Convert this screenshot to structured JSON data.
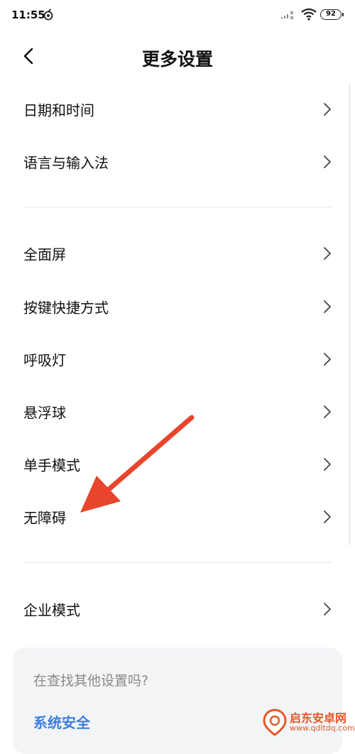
{
  "status_bar": {
    "time": "11:55",
    "battery": "92",
    "icons": [
      "app-notification-icon",
      "signal-off-icon",
      "wifi-icon",
      "battery-icon"
    ]
  },
  "header": {
    "title": "更多设置",
    "back_icon": "back-arrow-icon"
  },
  "settings": {
    "group1": [
      {
        "label": "日期和时间"
      },
      {
        "label": "语言与输入法"
      }
    ],
    "group2": [
      {
        "label": "全面屏"
      },
      {
        "label": "按键快捷方式"
      },
      {
        "label": "呼吸灯"
      },
      {
        "label": "悬浮球"
      },
      {
        "label": "单手模式"
      },
      {
        "label": "无障碍"
      }
    ],
    "group3": [
      {
        "label": "企业模式"
      }
    ]
  },
  "suggestion": {
    "title": "在查找其他设置吗?",
    "link": "系统安全"
  },
  "annotation": {
    "arrow_color": "#e8452c",
    "points_to": "无障碍"
  },
  "watermark": {
    "name": "启东安卓网",
    "url": "www.qdltdq.com"
  },
  "colors": {
    "accent": "#3d7fe0",
    "card_bg": "#f3f4f6",
    "divider": "#e6e6e6"
  }
}
